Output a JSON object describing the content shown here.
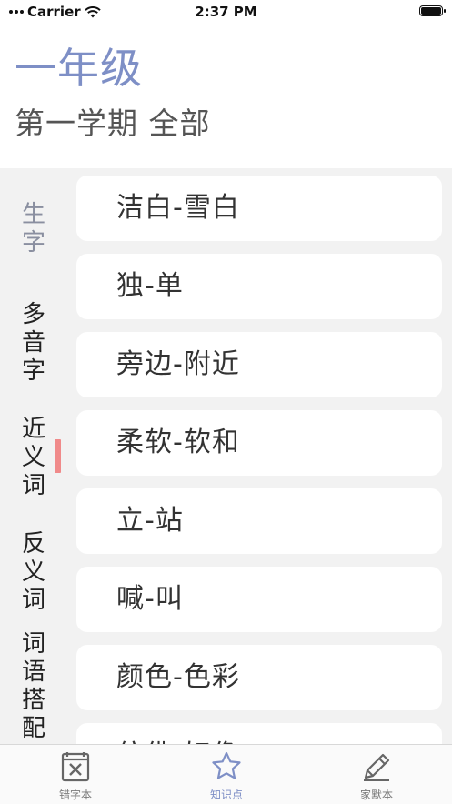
{
  "status_bar": {
    "carrier": "Carrier",
    "time": "2:37 PM"
  },
  "header": {
    "grade": "一年级",
    "semester": "第一学期 全部"
  },
  "side_nav": {
    "items": [
      {
        "label": "生字",
        "active": false
      },
      {
        "label": "多音字",
        "active": false
      },
      {
        "label": "近义词",
        "active": true
      },
      {
        "label": "反义词",
        "active": false
      },
      {
        "label": "词语搭配",
        "active": false
      }
    ]
  },
  "word_list": [
    "洁白-雪白",
    "独-单",
    "旁边-附近",
    "柔软-软和",
    "立-站",
    "喊-叫",
    "颜色-色彩",
    "仿佛-好像"
  ],
  "tab_bar": {
    "tabs": [
      {
        "label": "错字本",
        "icon": "notebook-x-icon",
        "active": false
      },
      {
        "label": "知识点",
        "icon": "star-icon",
        "active": true
      },
      {
        "label": "家默本",
        "icon": "pencil-icon",
        "active": false
      }
    ]
  },
  "colors": {
    "accent": "#7e8fc6",
    "indicator": "#f08a8a",
    "background": "#f2f2f2"
  }
}
